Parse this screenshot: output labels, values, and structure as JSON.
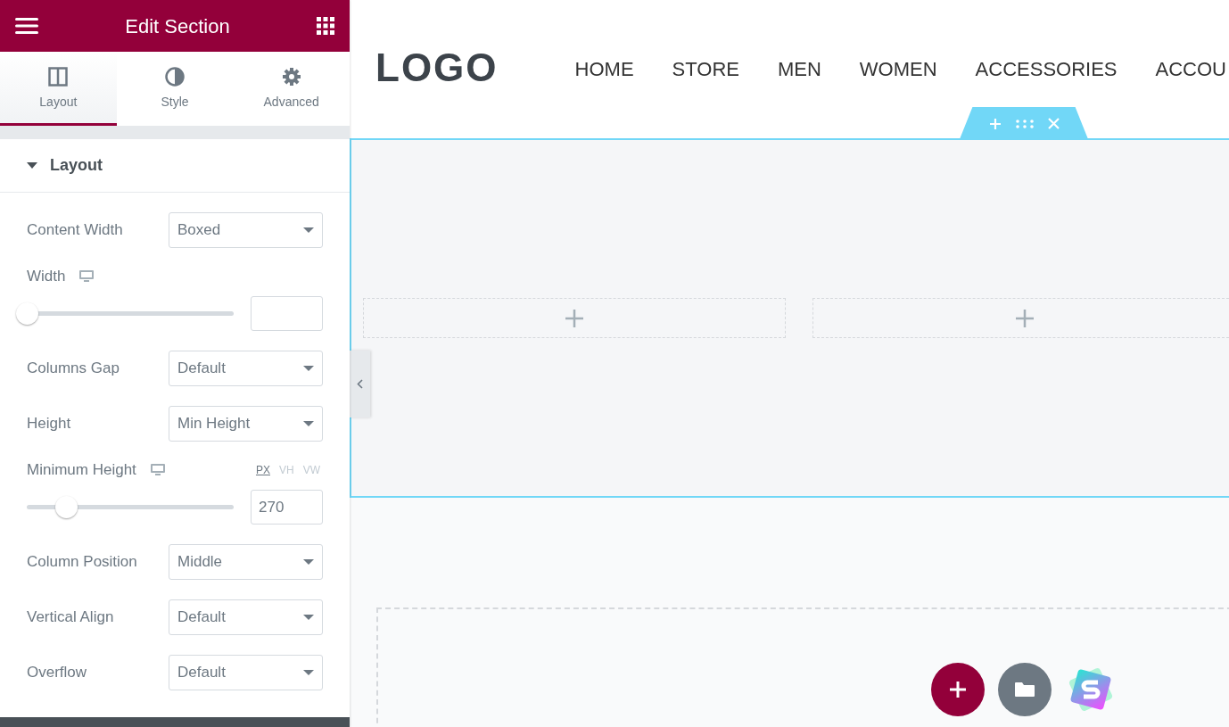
{
  "panel": {
    "title": "Edit Section"
  },
  "tabs": [
    {
      "label": "Layout",
      "selected": true
    },
    {
      "label": "Style",
      "selected": false
    },
    {
      "label": "Advanced",
      "selected": false
    }
  ],
  "section": {
    "title": "Layout",
    "expanded": true
  },
  "controls": [
    {
      "kind": "select",
      "label": "Content Width",
      "value": "Boxed"
    },
    {
      "kind": "slider",
      "label": "Width",
      "responsive": true,
      "level": 0
    },
    {
      "kind": "select",
      "label": "Columns Gap",
      "value": "Default"
    },
    {
      "kind": "select",
      "label": "Height",
      "value": "Min Height"
    },
    {
      "kind": "slider",
      "label": "Minimum Height",
      "responsive": true,
      "units": [
        {
          "label": "PX",
          "selected": true
        },
        {
          "label": "VH",
          "selected": false
        },
        {
          "label": "VW",
          "selected": false
        }
      ],
      "level": 0.19,
      "value": "270"
    },
    {
      "kind": "select",
      "label": "Column Position",
      "value": "Middle"
    },
    {
      "kind": "select",
      "label": "Vertical Align",
      "value": "Default"
    },
    {
      "kind": "select",
      "label": "Overflow",
      "value": "Default"
    }
  ],
  "site": {
    "logo": "LOGO",
    "nav": [
      "HOME",
      "STORE",
      "MEN",
      "WOMEN",
      "ACCESSORIES",
      "ACCOU"
    ]
  }
}
